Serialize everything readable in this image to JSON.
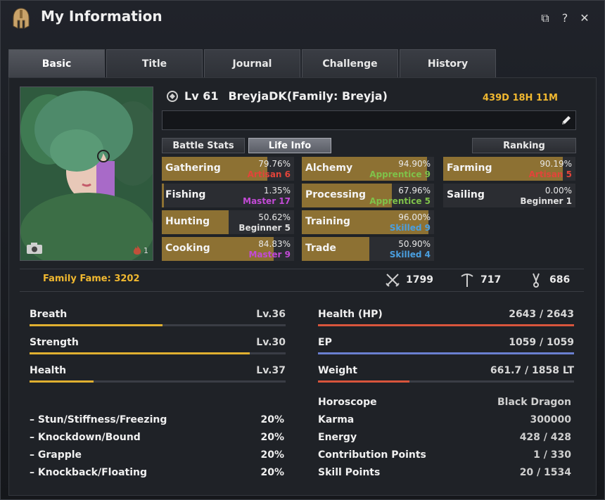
{
  "window": {
    "title": "My Information"
  },
  "tabs": [
    "Basic",
    "Title",
    "Journal",
    "Challenge",
    "History"
  ],
  "character": {
    "level": "Lv 61",
    "name": "BreyjaDK(Family: Breyja)",
    "playtime": "439D 18H 11M",
    "portrait_count": "1",
    "motto": ""
  },
  "buttons": {
    "battle_stats": "Battle Stats",
    "life_info": "Life Info",
    "ranking": "Ranking"
  },
  "life_skills": [
    {
      "name": "Gathering",
      "percent": "79.76%",
      "fill": 79.76,
      "rank": "Artisan 6",
      "rank_color": "#e2443a"
    },
    {
      "name": "Fishing",
      "percent": "1.35%",
      "fill": 1.35,
      "rank": "Master 17",
      "rank_color": "#c34ad6"
    },
    {
      "name": "Hunting",
      "percent": "50.62%",
      "fill": 50.62,
      "rank": "Beginner 5",
      "rank_color": "#e0e0e0"
    },
    {
      "name": "Cooking",
      "percent": "84.83%",
      "fill": 84.83,
      "rank": "Master 9",
      "rank_color": "#c34ad6"
    },
    {
      "name": "Alchemy",
      "percent": "94.90%",
      "fill": 94.9,
      "rank": "Apprentice 9",
      "rank_color": "#7fc24a"
    },
    {
      "name": "Processing",
      "percent": "67.96%",
      "fill": 67.96,
      "rank": "Apprentice 5",
      "rank_color": "#7fc24a"
    },
    {
      "name": "Training",
      "percent": "96.00%",
      "fill": 96.0,
      "rank": "Skilled 9",
      "rank_color": "#4a9fe0"
    },
    {
      "name": "Trade",
      "percent": "50.90%",
      "fill": 50.9,
      "rank": "Skilled 4",
      "rank_color": "#4a9fe0"
    },
    {
      "name": "Farming",
      "percent": "90.19%",
      "fill": 90.19,
      "rank": "Artisan 5",
      "rank_color": "#e2443a"
    },
    {
      "name": "Sailing",
      "percent": "0.00%",
      "fill": 0,
      "rank": "Beginner 1",
      "rank_color": "#e0e0e0"
    }
  ],
  "family_fame": "Family Fame: 3202",
  "fame_stats": {
    "combat": "1799",
    "life": "717",
    "skill": "686"
  },
  "stats": {
    "breath": {
      "label": "Breath",
      "level": "Lv.36",
      "fill": 0.52
    },
    "strength": {
      "label": "Strength",
      "level": "Lv.30",
      "fill": 0.86
    },
    "health": {
      "label": "Health",
      "level": "Lv.37",
      "fill": 0.25
    }
  },
  "resists": [
    {
      "label": "– Stun/Stiffness/Freezing",
      "value": "20%"
    },
    {
      "label": "– Knockdown/Bound",
      "value": "20%"
    },
    {
      "label": "– Grapple",
      "value": "20%"
    },
    {
      "label": "– Knockback/Floating",
      "value": "20%"
    }
  ],
  "vitals": {
    "hp": {
      "label": "Health (HP)",
      "value": "2643 / 2643",
      "fill": 1.0,
      "color": "#d8553c"
    },
    "ep": {
      "label": "EP",
      "value": "1059 / 1059",
      "fill": 1.0,
      "color": "#6a7fd0"
    },
    "weight": {
      "label": "Weight",
      "value": "661.7 / 1858 LT",
      "fill": 0.356,
      "color": "#d8553c"
    }
  },
  "info": [
    {
      "label": "Horoscope",
      "value": "Black Dragon"
    },
    {
      "label": "Karma",
      "value": "300000"
    },
    {
      "label": "Energy",
      "value": "428 / 428"
    },
    {
      "label": "Contribution Points",
      "value": "1 / 330"
    },
    {
      "label": "Skill Points",
      "value": "20 / 1534"
    }
  ]
}
